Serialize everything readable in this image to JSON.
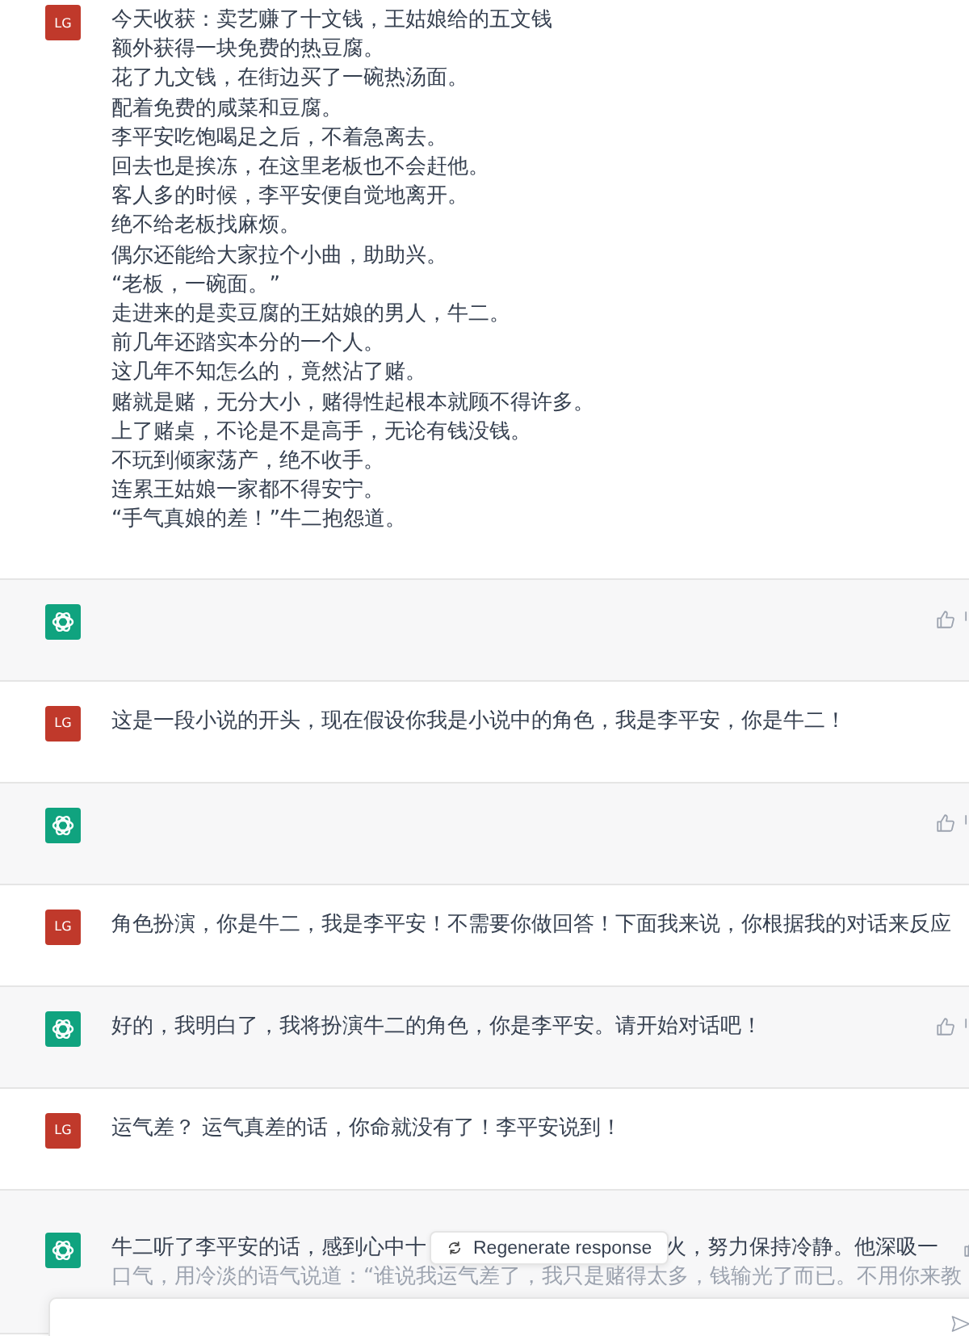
{
  "messages": [
    {
      "kind": "user",
      "avatar": "LG",
      "lines": [
        "今天收获：卖艺赚了十文钱，王姑娘给的五文钱",
        "额外获得一块免费的热豆腐。",
        "花了九文钱，在街边买了一碗热汤面。",
        "配着免费的咸菜和豆腐。",
        "李平安吃饱喝足之后，不着急离去。",
        "回去也是挨冻，在这里老板也不会赶他。",
        "客人多的时候，李平安便自觉地离开。",
        "绝不给老板找麻烦。",
        "偶尔还能给大家拉个小曲，助助兴。",
        "“老板，一碗面。”",
        "走进来的是卖豆腐的王姑娘的男人，牛二。",
        "前几年还踏实本分的一个人。",
        "这几年不知怎么的，竟然沾了赌。",
        "赌就是赌，无分大小，赌得性起根本就顾不得许多。",
        "上了赌桌，不论是不是高手，无论有钱没钱。",
        "不玩到倾家荡产，绝不收手。",
        "连累王姑娘一家都不得安宁。",
        "“手气真娘的差！”牛二抱怨道。"
      ]
    },
    {
      "kind": "assistant"
    },
    {
      "kind": "user",
      "avatar": "LG",
      "lines": [
        "这是一段小说的开头，现在假设你我是小说中的角色，我是李平安，你是牛二！"
      ]
    },
    {
      "kind": "assistant"
    },
    {
      "kind": "user",
      "avatar": "LG",
      "lines": [
        "角色扮演，你是牛二，我是李平安！不需要你做回答！下面我来说，你根据我的对话来反应"
      ]
    },
    {
      "kind": "assistant",
      "lines": [
        "好的，我明白了，我将扮演牛二的角色，你是李平安。请开始对话吧！"
      ]
    },
    {
      "kind": "user",
      "avatar": "LG",
      "lines": [
        "运气差？ 运气真差的话，你命就没有了！李平安说到！"
      ]
    },
    {
      "kind": "assistant",
      "first_line_parts": [
        "牛二听了李平安的话，感到心中十",
        "火，努力保持冷静。他深吸一"
      ],
      "lines": [
        "口气，用冷淡的语气说道：“谁说我运气差了，我只是赌得太多，钱输光了而已。不用你来教"
      ]
    }
  ],
  "regenerate_button": "Regenerate response"
}
